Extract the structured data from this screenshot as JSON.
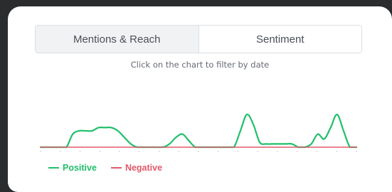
{
  "tabs": [
    {
      "label": "Mentions & Reach",
      "state": "inactive"
    },
    {
      "label": "Sentiment",
      "state": "active"
    }
  ],
  "subtitle": "Click on the chart to filter by date",
  "colors": {
    "positive": "#1fbf6a",
    "negative": "#e05a6a",
    "tick": "#b8bcc2"
  },
  "chart_data": {
    "type": "area",
    "x": [
      0,
      1,
      2,
      3,
      4,
      5,
      6,
      7,
      8,
      9,
      10,
      11,
      12,
      13,
      14,
      15,
      16,
      17,
      18,
      19,
      20,
      21,
      22,
      23,
      24,
      25,
      26,
      27,
      28,
      29,
      30,
      31,
      32,
      33,
      34,
      35,
      36,
      37,
      38,
      39,
      40,
      41,
      42,
      43,
      44,
      45,
      46,
      47,
      48,
      49
    ],
    "series": [
      {
        "name": "Positive",
        "values": [
          0,
          0,
          0,
          0,
          0,
          0.4,
          0.5,
          0.5,
          0.5,
          0.6,
          0.6,
          0.6,
          0.5,
          0.3,
          0.1,
          0,
          0,
          0,
          0,
          0,
          0.1,
          0.3,
          0.4,
          0.2,
          0,
          0,
          0,
          0,
          0,
          0,
          0,
          0.5,
          1.0,
          0.7,
          0.15,
          0.1,
          0.1,
          0.1,
          0.1,
          0.1,
          0,
          0,
          0.1,
          0.4,
          0.25,
          0.6,
          1.0,
          0.5,
          0,
          0
        ]
      },
      {
        "name": "Negative",
        "values": [
          0,
          0,
          0,
          0,
          0,
          0,
          0,
          0,
          0,
          0,
          0,
          0,
          0,
          0,
          0,
          0,
          0,
          0,
          0,
          0,
          0,
          0,
          0,
          0,
          0,
          0,
          0,
          0,
          0,
          0,
          0,
          0,
          0,
          0,
          0,
          0,
          0,
          0,
          0,
          0,
          0,
          0,
          0,
          0,
          0,
          0,
          0,
          0,
          0,
          0
        ]
      }
    ],
    "grid": false,
    "legend_position": "bottom-left"
  },
  "legend": [
    {
      "label": "Positive"
    },
    {
      "label": "Negative"
    }
  ]
}
